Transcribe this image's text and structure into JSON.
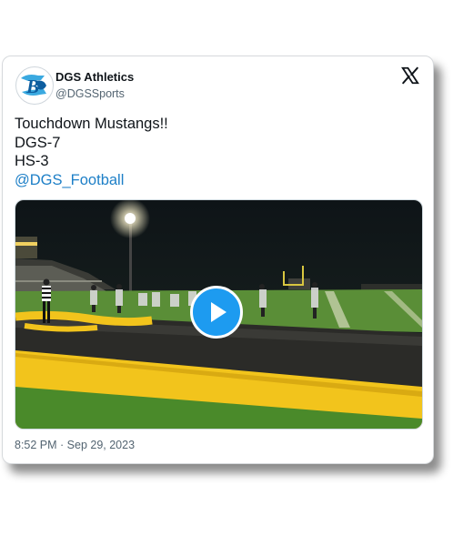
{
  "author": {
    "display_name": "DGS Athletics",
    "handle": "@DGSSports",
    "avatar_icon": "dgs-bulldog-logo-icon"
  },
  "platform_icon": "x-logo-icon",
  "tweet": {
    "lines": [
      "Touchdown Mustangs!!",
      "DGS-7",
      "HS-3"
    ],
    "mention": "@DGS_Football"
  },
  "media": {
    "type": "video",
    "play_icon": "play-icon",
    "scene": "football-field-night"
  },
  "timestamp": "8:52 PM · Sep 29, 2023",
  "colors": {
    "link": "#1d7fc7",
    "play_button": "#1d9bf0",
    "field_gold": "#f2c41c",
    "field_green": "#4a8a2a"
  }
}
